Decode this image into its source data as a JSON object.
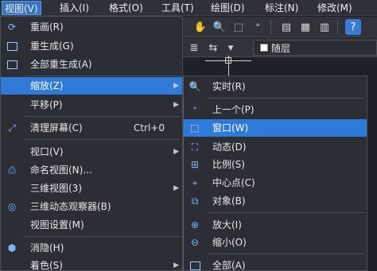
{
  "menubar": {
    "items": [
      "视图(V)",
      "插入(I)",
      "格式(O)",
      "工具(T)",
      "绘图(D)",
      "标注(N)",
      "修改(M)"
    ]
  },
  "layer": {
    "name": "随层"
  },
  "view_menu": {
    "items": [
      {
        "label": "重画(R)",
        "icon": "redraw-icon"
      },
      {
        "label": "重生成(G)",
        "icon": "regen-icon"
      },
      {
        "label": "全部重生成(A)",
        "icon": "regen-all-icon"
      },
      {
        "label": "缩放(Z)",
        "icon": "",
        "submenu": true
      },
      {
        "label": "平移(P)",
        "icon": "",
        "submenu": true
      },
      {
        "label": "清理屏幕(C)",
        "icon": "clean-screen-icon",
        "shortcut": "Ctrl+0"
      },
      {
        "label": "视口(V)",
        "icon": "",
        "submenu": true
      },
      {
        "label": "命名视图(N)...",
        "icon": "named-view-icon"
      },
      {
        "label": "三维视图(3)",
        "icon": "",
        "submenu": true
      },
      {
        "label": "三维动态观察器(B)",
        "icon": "3d-orbit-icon"
      },
      {
        "label": "视图设置(M)",
        "icon": ""
      },
      {
        "label": "消隐(H)",
        "icon": "hide-icon"
      },
      {
        "label": "着色(S)",
        "icon": "",
        "submenu": true
      }
    ]
  },
  "zoom_menu": {
    "items": [
      {
        "label": "实时(R)",
        "icon": "zoom-realtime-icon"
      },
      {
        "label": "上一个(P)",
        "icon": "zoom-previous-icon"
      },
      {
        "label": "窗口(W)",
        "icon": "zoom-window-icon"
      },
      {
        "label": "动态(D)",
        "icon": "zoom-dynamic-icon"
      },
      {
        "label": "比例(S)",
        "icon": "zoom-scale-icon"
      },
      {
        "label": "中心点(C)",
        "icon": "zoom-center-icon"
      },
      {
        "label": "对象(B)",
        "icon": "zoom-object-icon"
      },
      {
        "label": "放大(I)",
        "icon": "zoom-in-icon"
      },
      {
        "label": "缩小(O)",
        "icon": "zoom-out-icon"
      },
      {
        "label": "全部(A)",
        "icon": "zoom-all-icon"
      }
    ]
  },
  "colors": {
    "highlight": "#2f7ad8",
    "menu_bg": "#2b2e35",
    "icon": "#7fb6ff"
  }
}
